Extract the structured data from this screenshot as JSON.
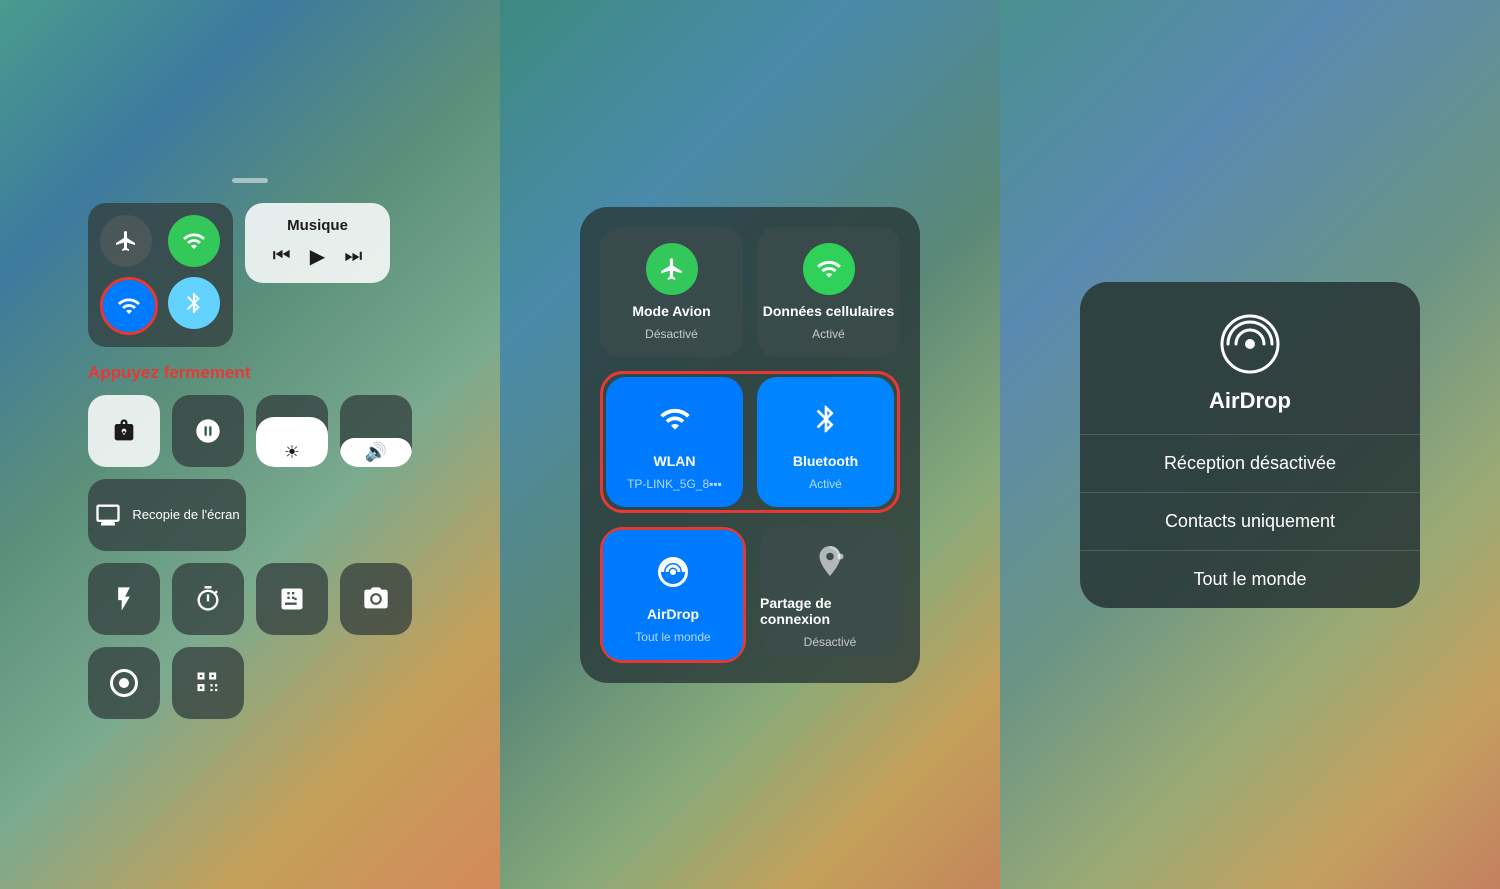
{
  "panel1": {
    "appuyez_text": "Appuyez fermement",
    "music_title": "Musique",
    "row2": {
      "recopie_label": "Recopie de l'écran"
    }
  },
  "panel2": {
    "tiles": [
      {
        "name": "Mode Avion",
        "status": "Désactivé",
        "type": "airplane",
        "active": false
      },
      {
        "name": "Données cellulaires",
        "status": "Activé",
        "type": "cellular",
        "active": true
      },
      {
        "name": "WLAN",
        "status": "TP-LINK_5G_8▪▪▪▪",
        "type": "wifi",
        "active": true
      },
      {
        "name": "Bluetooth",
        "status": "Activé",
        "type": "bluetooth",
        "active": true
      },
      {
        "name": "AirDrop",
        "status": "Tout le monde",
        "type": "airdrop",
        "active": true
      },
      {
        "name": "Partage de connexion",
        "status": "Désactivé",
        "type": "hotspot",
        "active": false
      }
    ]
  },
  "panel3": {
    "title": "AirDrop",
    "options": [
      {
        "label": "Réception désactivée",
        "selected": false
      },
      {
        "label": "Contacts uniquement",
        "selected": false
      },
      {
        "label": "Tout le monde",
        "selected": true
      }
    ]
  }
}
